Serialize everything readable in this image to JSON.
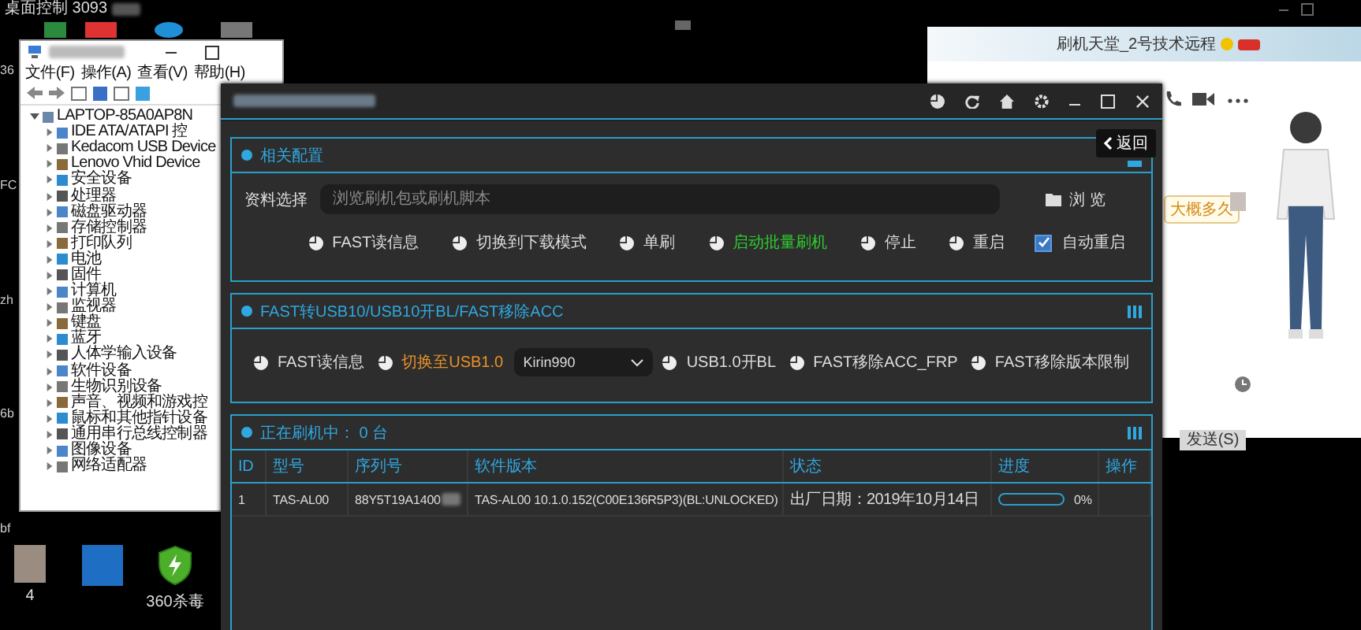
{
  "remote_bar": {
    "title": "桌面控制 3093"
  },
  "desktop_edge_labels": [
    "36",
    "FC",
    "zh",
    "6b",
    "bf"
  ],
  "desktop_icons": [
    {
      "kind": "photo",
      "label": "4"
    },
    {
      "kind": "app"
    },
    {
      "kind": "shield",
      "label": "360杀毒"
    }
  ],
  "device_manager": {
    "menu": [
      "文件(F)",
      "操作(A)",
      "查看(V)",
      "帮助(H)"
    ],
    "tree": {
      "label": "LAPTOP-85A0AP8N",
      "expanded": true,
      "children": [
        {
          "label": "IDE ATA/ATAPI 控",
          "expanded": false
        },
        {
          "label": "Kedacom USB Device",
          "expanded": false
        },
        {
          "label": "Lenovo Vhid Device",
          "expanded": false
        },
        {
          "label": "安全设备",
          "expanded": false
        },
        {
          "label": "处理器",
          "expanded": false
        },
        {
          "label": "磁盘驱动器",
          "expanded": false
        },
        {
          "label": "存储控制器",
          "expanded": false
        },
        {
          "label": "打印队列",
          "expanded": false
        },
        {
          "label": "电池",
          "expanded": false
        },
        {
          "label": "固件",
          "expanded": false
        },
        {
          "label": "计算机",
          "expanded": false
        },
        {
          "label": "监视器",
          "expanded": false
        },
        {
          "label": "键盘",
          "expanded": false
        },
        {
          "label": "蓝牙",
          "expanded": false
        },
        {
          "label": "人体学输入设备",
          "expanded": false
        },
        {
          "label": "软件设备",
          "expanded": false
        },
        {
          "label": "生物识别设备",
          "expanded": false
        },
        {
          "label": "声音、视频和游戏控",
          "expanded": false
        },
        {
          "label": "鼠标和其他指针设备",
          "expanded": false
        },
        {
          "label": "通用串行总线控制器",
          "expanded": false
        },
        {
          "label": "图像设备",
          "expanded": false
        },
        {
          "label": "网络适配器",
          "expanded": false
        }
      ]
    }
  },
  "flash_tool": {
    "config": {
      "title": "相关配置",
      "file_label": "资料选择",
      "file_field": {
        "placeholder": "浏览刷机包或刷机脚本"
      },
      "browse_button": "浏 览",
      "actions": [
        {
          "label": "FAST读信息",
          "color": "#dddddd"
        },
        {
          "label": "切换到下载模式",
          "color": "#dddddd"
        },
        {
          "label": "单刷",
          "color": "#dddddd"
        },
        {
          "label": "启动批量刷机",
          "color": "#2ecc2e"
        },
        {
          "label": "停止",
          "color": "#dddddd"
        },
        {
          "label": "重启",
          "color": "#dddddd"
        }
      ],
      "auto_restart": {
        "label": "自动重启",
        "checked": true
      }
    },
    "fast_usb": {
      "title": "FAST转USB10/USB10开BL/FAST移除ACC",
      "actions": [
        {
          "kind": "button",
          "label": "FAST读信息",
          "color": "#dddddd"
        },
        {
          "kind": "button",
          "label": "切换至USB1.0",
          "color": "#e8922a"
        },
        {
          "kind": "select",
          "value": "Kirin990"
        },
        {
          "kind": "button",
          "label": "USB1.0开BL",
          "color": "#dddddd"
        },
        {
          "kind": "button",
          "label": "FAST移除ACC_FRP",
          "color": "#dddddd"
        },
        {
          "kind": "button",
          "label": "FAST移除版本限制",
          "color": "#dddddd"
        }
      ]
    },
    "flashing": {
      "title": "正在刷机中： 0 台",
      "columns": [
        "ID",
        "型号",
        "序列号",
        "软件版本",
        "状态",
        "进度",
        "操作"
      ],
      "rows": [
        {
          "id": "1",
          "model": "TAS-AL00",
          "serial": "88Y5T19A1400",
          "software": "TAS-AL00 10.1.0.152(C00E136R5P3)(BL:UNLOCKED)",
          "status": "出厂日期：2019年10月14日",
          "level": 0,
          "progress": "0%"
        }
      ]
    }
  },
  "back_tooltip": {
    "label": "返回"
  },
  "chat": {
    "title": "刷机天堂_2号技术远程",
    "message": "大概多久",
    "send_button": "发送(S)"
  }
}
